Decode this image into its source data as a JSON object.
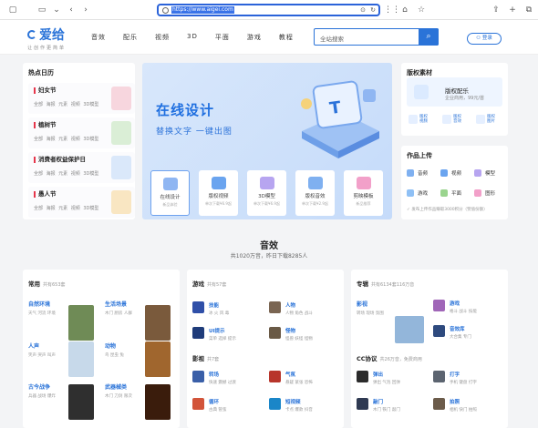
{
  "browser": {
    "url": "https://www.aigei.com"
  },
  "site": {
    "logo_name": "爱给",
    "logo_slogan": "让创作更简单",
    "nav": [
      "音效",
      "配乐",
      "视频",
      "3D",
      "平面",
      "游戏",
      "教程"
    ],
    "search_placeholder": "全站搜索",
    "login": "登录"
  },
  "hot": {
    "title": "热点日历",
    "items": [
      {
        "title": "妇女节",
        "tags": "全部 海报 元素 视频 3D模型",
        "color": "#f6a7b8"
      },
      {
        "title": "植树节",
        "tags": "全部 海报 元素 视频 3D模型",
        "color": "#9ad48e"
      },
      {
        "title": "消费者权益保护日",
        "tags": "全部 海报 元素 视频 3D模型",
        "color": "#8fc0f5"
      },
      {
        "title": "愚人节",
        "tags": "全部 海报 元素 视频 3D模型",
        "color": "#f5cf8a"
      }
    ]
  },
  "banner": {
    "headline": "在线设计",
    "sub": "替换文字 一键出图",
    "tools": [
      {
        "name": "在线设计",
        "desc": "新品体验",
        "color": "#8fb6f2"
      },
      {
        "name": "版权视频",
        "desc": "单次下载¥6.9起",
        "color": "#6aa4ef"
      },
      {
        "name": "3D模型",
        "desc": "单次下载¥6.9起",
        "color": "#b7a5f0"
      },
      {
        "name": "版权音效",
        "desc": "单次下载¥2.9起",
        "color": "#7fb0f0"
      },
      {
        "name": "剪映模板",
        "desc": "新品推荐",
        "color": "#f2a0c9"
      }
    ]
  },
  "ads": {
    "title": "版权素材",
    "featured_title": "版权配乐",
    "featured_price": "企业商用，99元/首",
    "links": [
      {
        "label": "版权视频"
      },
      {
        "label": "版权音效"
      },
      {
        "label": "版权图片"
      }
    ]
  },
  "upload": {
    "title": "作品上传",
    "items": [
      "音频",
      "视频",
      "模型",
      "游戏",
      "平面",
      "图形"
    ],
    "note": "✓ 发布上传作品赚取3000积分（赞值份额）"
  },
  "section": {
    "title": "音效",
    "stats": "共1020万音，昨日下载8285人"
  },
  "common": {
    "title": "常用",
    "count": "共有653套",
    "entries": [
      {
        "title": "自然环境",
        "tags": "天气 河流 环境",
        "color": "#6f8b56"
      },
      {
        "title": "生活场景",
        "tags": "木门 厨房 人群",
        "color": "#7a5a3c"
      },
      {
        "title": "人声",
        "tags": "笑声 哭声 叫声",
        "color": "#c7d9ea"
      },
      {
        "title": "动物",
        "tags": "鸟 昆虫 兔",
        "color": "#a0662e"
      },
      {
        "title": "古今战争",
        "tags": "兵器 战场 爆炸",
        "color": "#2f2f2f"
      },
      {
        "title": "武器械类",
        "tags": "木门 刀剑 限次",
        "color": "#3a1c0c"
      }
    ]
  },
  "games": {
    "title": "游戏",
    "count": "共有57套",
    "entries": [
      {
        "title": "技能",
        "tags": "冰 火 风 毒",
        "color": "#2f4fa8"
      },
      {
        "title": "人物",
        "tags": "人物 角色 战斗",
        "color": "#7a6552"
      },
      {
        "title": "UI提示",
        "tags": "菜单 选择 提示",
        "color": "#1f3c7a"
      },
      {
        "title": "怪物",
        "tags": "怪兽 妖怪 怪物",
        "color": "#6a5a46"
      }
    ]
  },
  "film": {
    "title": "影视",
    "count": "共7套",
    "entries": [
      {
        "title": "转场",
        "tags": "快速 震撼 过渡",
        "color": "#3a5fa8"
      },
      {
        "title": "气氛",
        "tags": "悬疑 紧张 恐怖",
        "color": "#b8352b"
      },
      {
        "title": "循环",
        "tags": "古典 管弦",
        "color": "#d2543a"
      },
      {
        "title": "短视频",
        "tags": "卡点 爆款 抖音",
        "color": "#1a86c8"
      }
    ]
  },
  "pro": {
    "title": "专辑",
    "count": "共有6134套116万音",
    "entries": [
      {
        "title": "影视",
        "tags": "转场 现场 氛围",
        "color": "#93b6da"
      },
      {
        "title": "游戏",
        "tags": "格斗 战斗 技能",
        "color": "#a066b8"
      },
      {
        "title": "音效库",
        "tags": "大合集 专门",
        "color": "#2e4a7e"
      }
    ]
  },
  "cc": {
    "title": "CC协议",
    "count": "共26万音，免费商用",
    "entries": [
      {
        "title": "弹出",
        "tags": "弹出 气泡 回弹",
        "color": "#2b2b2b"
      },
      {
        "title": "打字",
        "tags": "手机 键盘 打字",
        "color": "#5c6470"
      },
      {
        "title": "敲门",
        "tags": "木门 铁门 敲门",
        "color": "#2f3a52"
      },
      {
        "title": "拍照",
        "tags": "相机 快门 拍照",
        "color": "#6b5b4a"
      }
    ]
  }
}
